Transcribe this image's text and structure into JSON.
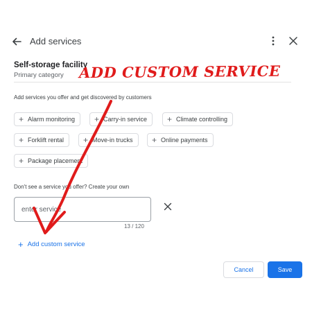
{
  "header": {
    "title": "Add services"
  },
  "category": {
    "name": "Self-storage facility",
    "label": "Primary category"
  },
  "intro": "Add services you offer and get discovered by customers",
  "chips": [
    "Alarm monitoring",
    "Carry-in service",
    "Climate controlling",
    "Forklift rental",
    "Move-in trucks",
    "Online payments",
    "Package placement"
  ],
  "own": {
    "prompt": "Don't see a service you offer? Create your own",
    "placeholder": "enter service",
    "count": "13 / 120",
    "add_label": "Add custom service"
  },
  "actions": {
    "cancel": "Cancel",
    "save": "Save"
  },
  "annotation": {
    "text": "ADD CUSTOM SERVICE",
    "color": "#e01b1b"
  },
  "colors": {
    "accent": "#1a73e8"
  }
}
